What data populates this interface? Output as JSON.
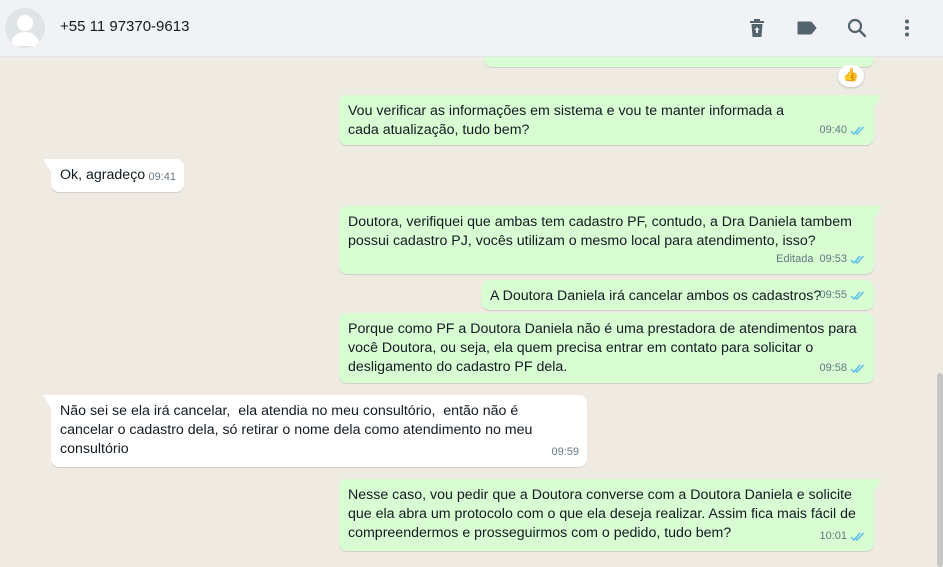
{
  "header": {
    "contact_name": "+55 11 97370-9613"
  },
  "icons": {
    "avatar": "default-avatar-icon",
    "delete": "trash-icon",
    "label": "label-tag-icon",
    "search": "search-icon",
    "menu": "more-vertical-icon"
  },
  "colors": {
    "outgoing_bubble": "#d9fdd3",
    "incoming_bubble": "#ffffff",
    "read_ticks": "#53bdeb",
    "background": "#efeae2"
  },
  "messages": [
    {
      "id": "m1",
      "direction": "out",
      "text": "Vou verificar as informações em sistema e vou te manter informada a cada atualização, tudo bem?",
      "time": "09:40",
      "edited": "",
      "ticks": "read"
    },
    {
      "id": "m2",
      "direction": "in",
      "text": "Ok, agradeço",
      "time": "09:41",
      "edited": ""
    },
    {
      "id": "m3",
      "direction": "out",
      "text": "Doutora, verifiquei que ambas tem cadastro PF, contudo, a Dra Daniela tambem possui cadastro PJ, vocês utilizam o mesmo local para atendimento, isso?",
      "time": "09:53",
      "edited": "Editada",
      "ticks": "read"
    },
    {
      "id": "m4",
      "direction": "out",
      "text": "A Doutora Daniela irá cancelar ambos os cadastros?",
      "time": "09:55",
      "edited": "",
      "ticks": "read"
    },
    {
      "id": "m5",
      "direction": "out",
      "text": "Porque como PF a Doutora Daniela não é uma prestadora de atendimentos para você Doutora, ou seja, ela quem precisa entrar em contato para solicitar o desligamento do cadastro PF dela.",
      "time": "09:58",
      "edited": "",
      "ticks": "read"
    },
    {
      "id": "m6",
      "direction": "in",
      "text": "Não sei se ela irá cancelar,  ela atendia no meu consultório,  então não é  cancelar o cadastro dela, só retirar o nome dela como atendimento no meu consultório",
      "time": "09:59",
      "edited": ""
    },
    {
      "id": "m7",
      "direction": "out",
      "text": "Nesse caso, vou pedir que a Doutora converse com a Doutora Daniela e solicite que ela abra um protocolo com o que ela deseja realizar. Assim fica mais fácil de compreendermos e prosseguirmos com o pedido, tudo bem?",
      "time": "10:01",
      "edited": "",
      "ticks": "read"
    }
  ],
  "reaction": {
    "emoji": "👍"
  }
}
